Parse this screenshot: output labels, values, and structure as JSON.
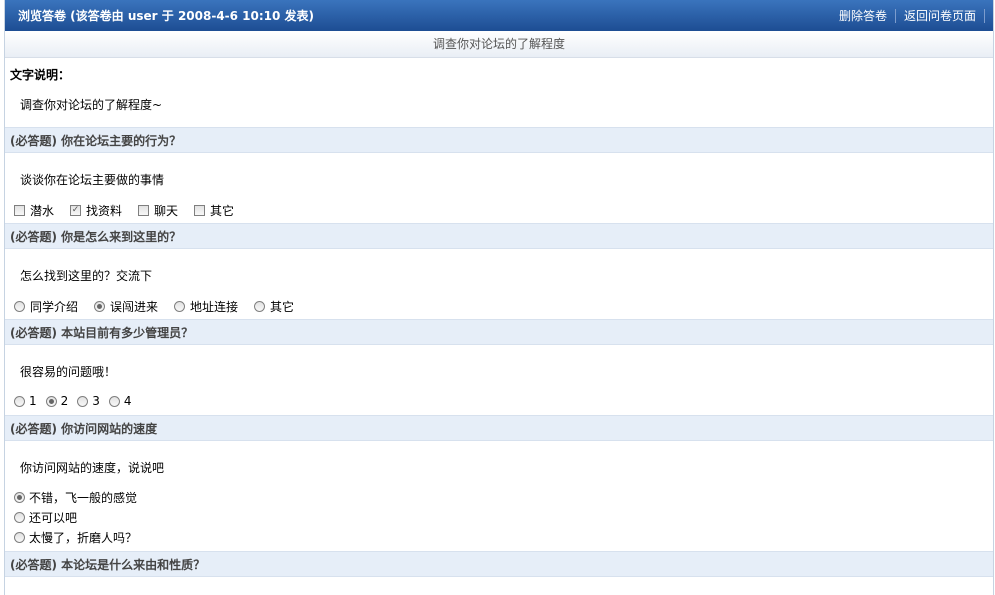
{
  "header": {
    "title": "浏览答卷 (该答卷由 user 于 2008-4-6 10:10 发表)",
    "delete_label": "删除答卷",
    "back_label": "返回问卷页面"
  },
  "subtitle": "调查你对论坛的了解程度",
  "description": {
    "label": "文字说明：",
    "text": "调查你对论坛的了解程度~"
  },
  "questions": [
    {
      "title": "(必答题) 你在论坛主要的行为？",
      "desc": "谈谈你在论坛主要做的事情",
      "type": "checkbox",
      "options": [
        "潜水",
        "找资料",
        "聊天",
        "其它"
      ],
      "selected": [
        1
      ]
    },
    {
      "title": "(必答题) 你是怎么来到这里的？",
      "desc": "怎么找到这里的？交流下",
      "type": "radio",
      "options": [
        "同学介绍",
        "误闯进来",
        "地址连接",
        "其它"
      ],
      "selected": 1
    },
    {
      "title": "(必答题) 本站目前有多少管理员？",
      "desc": "很容易的问题哦！",
      "type": "radio",
      "options": [
        "1",
        "2",
        "3",
        "4"
      ],
      "selected": 1
    },
    {
      "title": "(必答题) 你访问网站的速度",
      "desc": "你访问网站的速度，说说吧",
      "type": "radio",
      "options": [
        "不错，飞一般的感觉",
        "还可以吧",
        "太慢了，折磨人吗？"
      ],
      "selected": 0
    },
    {
      "title": "(必答题) 本论坛是什么来由和性质？"
    }
  ]
}
